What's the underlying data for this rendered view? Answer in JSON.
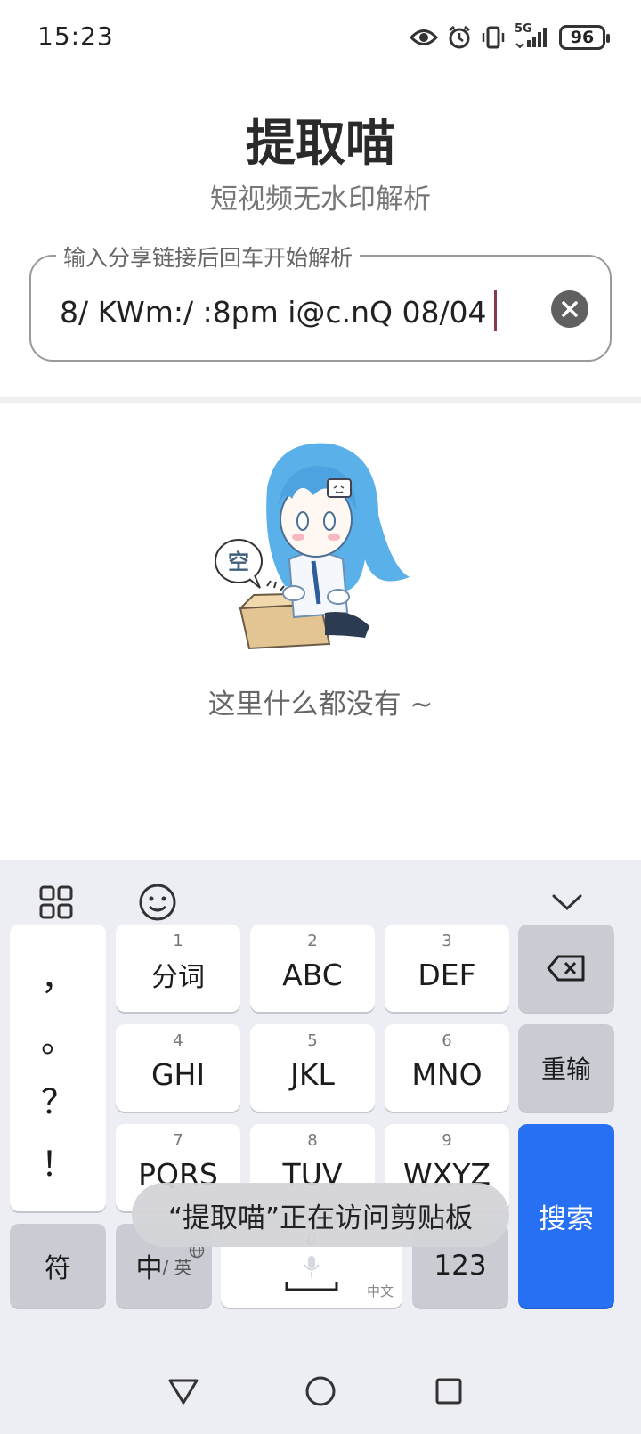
{
  "status_bar": {
    "time": "15:23",
    "network": "5G",
    "battery": "96",
    "icons": [
      "eye-icon",
      "alarm-icon",
      "vibrate-icon",
      "signal-icon",
      "battery-icon"
    ]
  },
  "header": {
    "title": "提取喵",
    "subtitle": "短视频无水印解析"
  },
  "search": {
    "label": "输入分享链接后回车开始解析",
    "value": "8/ KWm:/ :8pm i@c.nQ 08/04"
  },
  "empty_state": {
    "message": "这里什么都没有 ~",
    "badge": "空"
  },
  "keyboard": {
    "toolbar": [
      "grid-icon",
      "emoji-icon",
      "collapse-icon"
    ],
    "punctuation": [
      "，",
      "。",
      "？",
      "！"
    ],
    "keys": [
      {
        "num": "1",
        "label": "分词"
      },
      {
        "num": "2",
        "label": "ABC"
      },
      {
        "num": "3",
        "label": "DEF"
      },
      {
        "num": "4",
        "label": "GHI"
      },
      {
        "num": "5",
        "label": "JKL"
      },
      {
        "num": "6",
        "label": "MNO"
      },
      {
        "num": "7",
        "label": "PQRS"
      },
      {
        "num": "8",
        "label": "TUV"
      },
      {
        "num": "9",
        "label": "WXYZ"
      }
    ],
    "reinput": "重输",
    "symbols": "符",
    "lang_main": "中",
    "lang_sub": "/ 英",
    "space_num": "0",
    "space_hint": "中文",
    "numbers": "123",
    "search": "搜索"
  },
  "toast": {
    "message": "“提取喵”正在访问剪贴板"
  },
  "colors": {
    "accent": "#2770f4",
    "caret": "#8a3a4a",
    "keyboard_bg": "#eceef3"
  }
}
